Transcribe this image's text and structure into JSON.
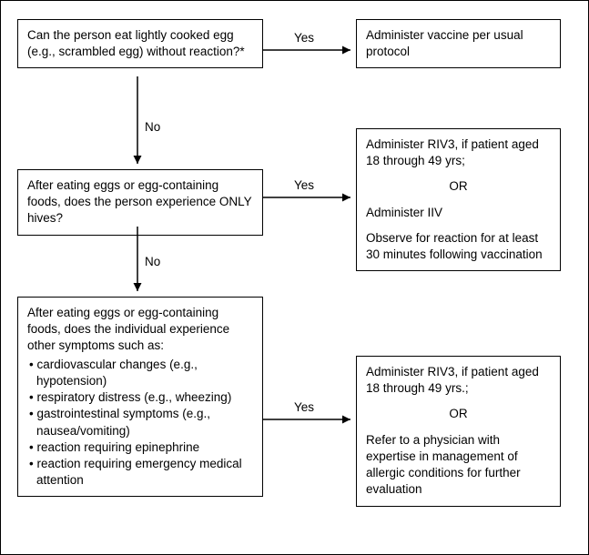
{
  "q1": {
    "text": "Can the person eat lightly cooked egg (e.g., scrambled egg) without reaction?*"
  },
  "a1": {
    "text": "Administer vaccine per usual protocol"
  },
  "q2": {
    "text": "After eating eggs or egg-containing foods, does the person experience ONLY hives?"
  },
  "a2": {
    "line1": "Administer RIV3, if patient aged 18 through 49 yrs;",
    "or": "OR",
    "line2": "Administer IIV",
    "line3": "Observe for reaction for at least 30 minutes following vaccination"
  },
  "q3": {
    "intro": "After eating eggs or egg-containing foods, does the individual experience other symptoms such as:",
    "bullets": [
      "cardiovascular changes (e.g., hypotension)",
      "respiratory distress (e.g., wheezing)",
      "gastrointestinal symptoms (e.g., nausea/vomiting)",
      "reaction requiring epinephrine",
      "reaction requiring emergency medical attention"
    ]
  },
  "a3": {
    "line1": "Administer RIV3, if patient aged 18 through 49 yrs.;",
    "or": "OR",
    "line2": "Refer to a physician with expertise in management of allergic conditions for further evaluation"
  },
  "labels": {
    "yes": "Yes",
    "no": "No"
  }
}
